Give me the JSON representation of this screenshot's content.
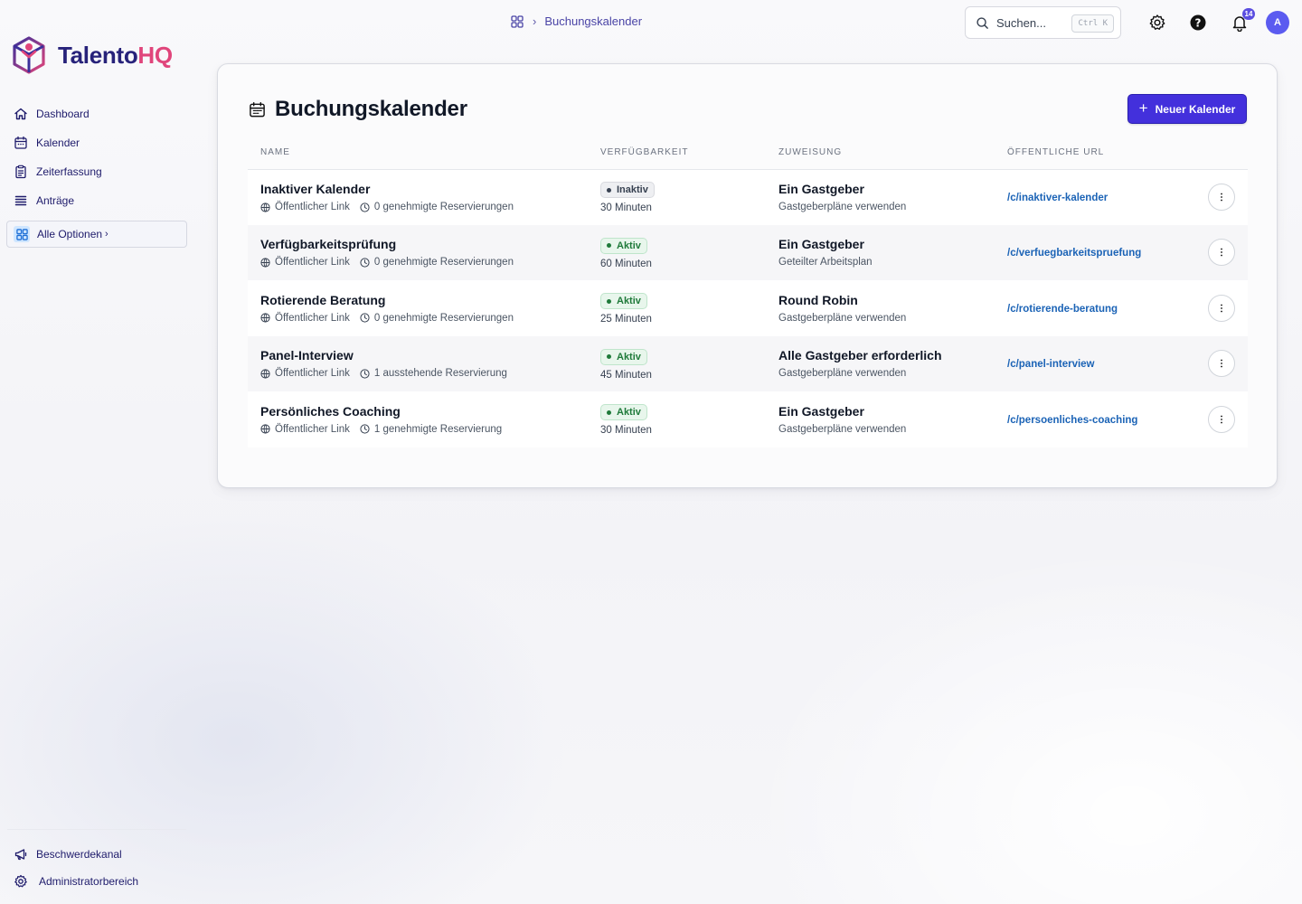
{
  "app": {
    "logo_part1": "Talento",
    "logo_part2": "HQ"
  },
  "sidebar": {
    "items": [
      {
        "label": "Dashboard",
        "icon": "home-icon"
      },
      {
        "label": "Kalender",
        "icon": "calendar-icon"
      },
      {
        "label": "Zeiterfassung",
        "icon": "clipboard-icon"
      },
      {
        "label": "Anträge",
        "icon": "list-icon"
      }
    ],
    "all_options_label": "Alle Optionen",
    "bottom_items": [
      {
        "label": "Beschwerdekanal",
        "icon": "megaphone-icon"
      },
      {
        "label": "Administratorbereich",
        "icon": "gear-icon"
      }
    ]
  },
  "topbar": {
    "breadcrumb_current": "Buchungskalender",
    "search_placeholder": "Suchen...",
    "search_shortcut": "Ctrl K",
    "notification_count": "14",
    "avatar_initial": "A"
  },
  "page": {
    "title": "Buchungskalender",
    "new_button_label": "Neuer Kalender",
    "columns": [
      "NAME",
      "VERFÜGBARKEIT",
      "ZUWEISUNG",
      "ÖFFENTLICHE URL"
    ],
    "rows": [
      {
        "name": "Inaktiver Kalender",
        "link_label": "Öffentlicher Link",
        "reservations": "0 genehmigte Reservierungen",
        "status": "Inaktiv",
        "duration": "30 Minuten",
        "assignment": "Ein Gastgeber",
        "assignment_detail": "Gastgeberpläne verwenden",
        "url": "/c/inaktiver-kalender"
      },
      {
        "name": "Verfügbarkeitsprüfung",
        "link_label": "Öffentlicher Link",
        "reservations": "0 genehmigte Reservierungen",
        "status": "Aktiv",
        "duration": "60 Minuten",
        "assignment": "Ein Gastgeber",
        "assignment_detail": "Geteilter Arbeitsplan",
        "url": "/c/verfuegbarkeitspruefung"
      },
      {
        "name": "Rotierende Beratung",
        "link_label": "Öffentlicher Link",
        "reservations": "0 genehmigte Reservierungen",
        "status": "Aktiv",
        "duration": "25 Minuten",
        "assignment": "Round Robin",
        "assignment_detail": "Gastgeberpläne verwenden",
        "url": "/c/rotierende-beratung"
      },
      {
        "name": "Panel-Interview",
        "link_label": "Öffentlicher Link",
        "reservations": "1 ausstehende Reservierung",
        "status": "Aktiv",
        "duration": "45 Minuten",
        "assignment": "Alle Gastgeber erforderlich",
        "assignment_detail": "Gastgeberpläne verwenden",
        "url": "/c/panel-interview"
      },
      {
        "name": "Persönliches Coaching",
        "link_label": "Öffentlicher Link",
        "reservations": "1 genehmigte Reservierung",
        "status": "Aktiv",
        "duration": "30 Minuten",
        "assignment": "Ein Gastgeber",
        "assignment_detail": "Gastgeberpläne verwenden",
        "url": "/c/persoenliches-coaching"
      }
    ]
  },
  "colors": {
    "primary": "#4330dc",
    "brand_dark": "#27227a",
    "brand_pink": "#e0457b",
    "active_green": "#1f7a3a",
    "link_blue": "#1b63b6"
  }
}
